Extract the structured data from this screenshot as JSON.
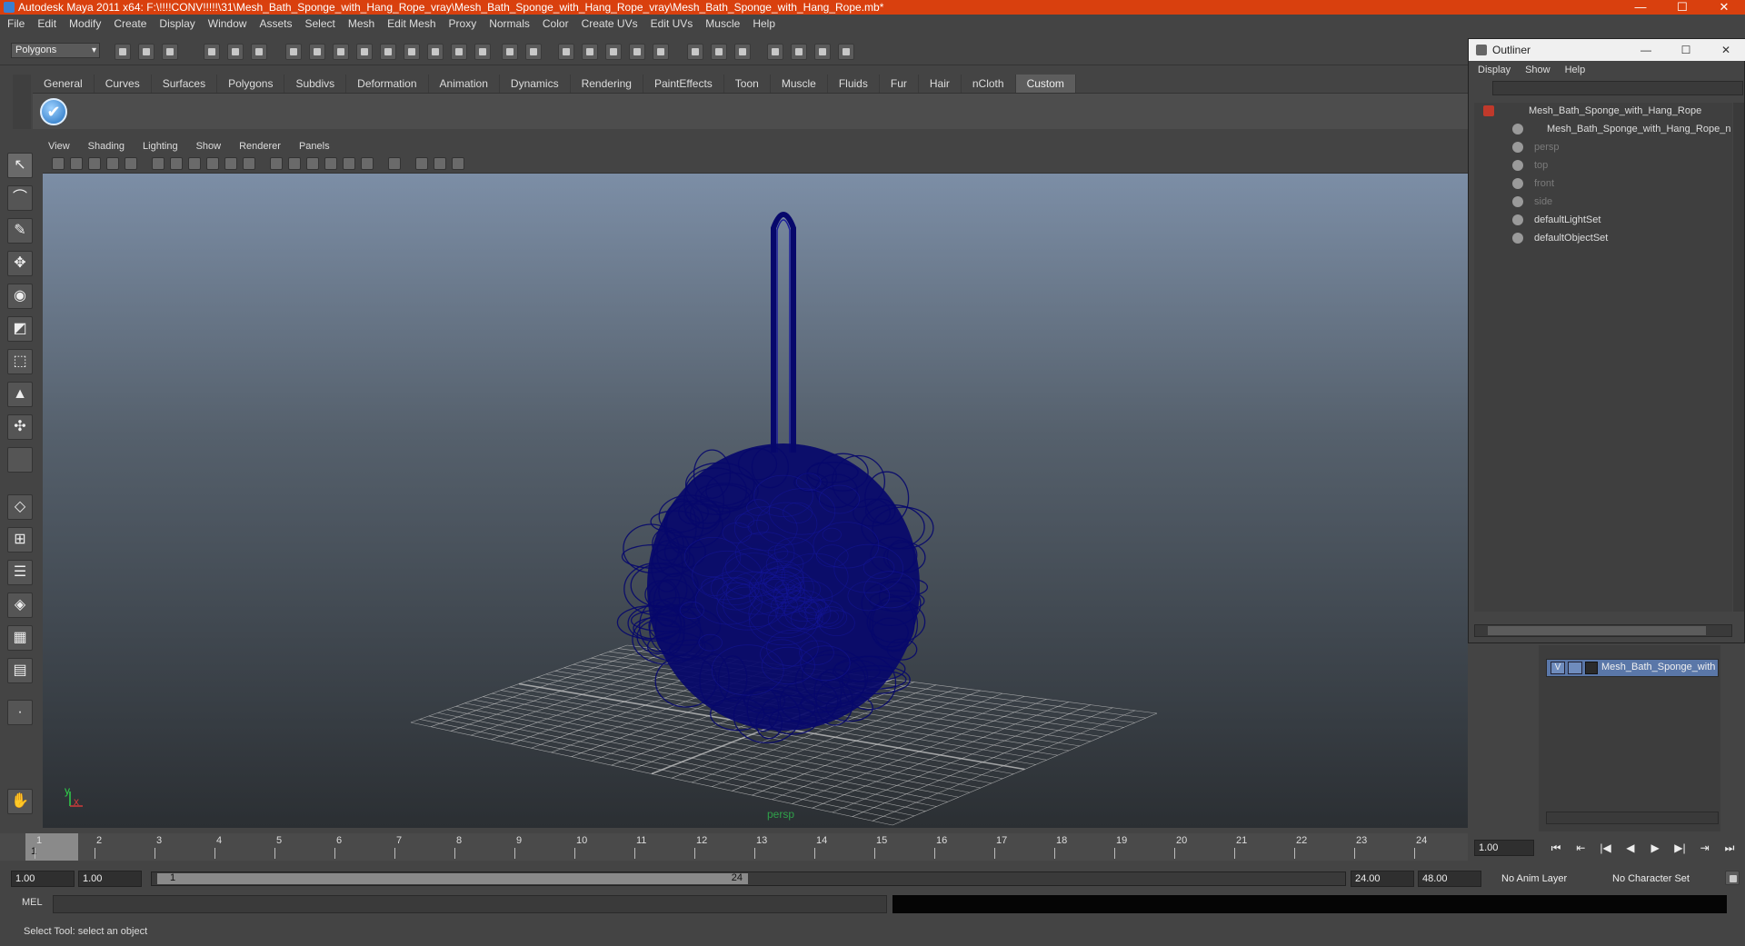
{
  "window": {
    "title": "Autodesk Maya 2011 x64: F:\\!!!!CONV!!!!!\\31\\Mesh_Bath_Sponge_with_Hang_Rope_vray\\Mesh_Bath_Sponge_with_Hang_Rope_vray\\Mesh_Bath_Sponge_with_Hang_Rope.mb*",
    "minimize": "—",
    "maximize": "☐",
    "close": "✕"
  },
  "menubar": [
    "File",
    "Edit",
    "Modify",
    "Create",
    "Display",
    "Window",
    "Assets",
    "Select",
    "Mesh",
    "Edit Mesh",
    "Proxy",
    "Normals",
    "Color",
    "Create UVs",
    "Edit UVs",
    "Muscle",
    "Help"
  ],
  "statusline": {
    "mode": "Polygons"
  },
  "shelf": {
    "tabs": [
      "General",
      "Curves",
      "Surfaces",
      "Polygons",
      "Subdivs",
      "Deformation",
      "Animation",
      "Dynamics",
      "Rendering",
      "PaintEffects",
      "Toon",
      "Muscle",
      "Fluids",
      "Fur",
      "Hair",
      "nCloth",
      "Custom"
    ],
    "active_tab": "Custom"
  },
  "viewport": {
    "menu": [
      "View",
      "Shading",
      "Lighting",
      "Show",
      "Renderer",
      "Panels"
    ],
    "camera_label": "persp",
    "axis_y": "y",
    "axis_x": "x",
    "mesh_color": "#07086b",
    "grid_color": "#c9c9c9"
  },
  "timeslider": {
    "ticks": [
      "1",
      "2",
      "3",
      "4",
      "5",
      "6",
      "7",
      "8",
      "9",
      "10",
      "11",
      "12",
      "13",
      "14",
      "15",
      "16",
      "17",
      "18",
      "19",
      "20",
      "21",
      "22",
      "23",
      "24"
    ],
    "current_frame": "1",
    "current_time": "1.00"
  },
  "playback": [
    "⏮",
    "⇤",
    "|◀",
    "◀",
    "▶",
    "▶|",
    "⇥",
    "⏭"
  ],
  "range": {
    "start": "1.00",
    "playback_start": "1.00",
    "handle_start": "1",
    "handle_end": "24",
    "playback_end": "24.00",
    "end": "48.00",
    "anim_layer": "No Anim Layer",
    "character_set": "No Character Set"
  },
  "commandline": {
    "label": "MEL"
  },
  "helpline": {
    "text": "Select Tool: select an object"
  },
  "outliner": {
    "title": "Outliner",
    "menu": [
      "Display",
      "Show",
      "Help"
    ],
    "items": [
      {
        "label": "Mesh_Bath_Sponge_with_Hang_Rope",
        "dim": false
      },
      {
        "label": "Mesh_Bath_Sponge_with_Hang_Rope_n",
        "dim": false
      },
      {
        "label": "persp",
        "dim": true
      },
      {
        "label": "top",
        "dim": true
      },
      {
        "label": "front",
        "dim": true
      },
      {
        "label": "side",
        "dim": true
      },
      {
        "label": "defaultLightSet",
        "dim": false
      },
      {
        "label": "defaultObjectSet",
        "dim": false
      }
    ]
  },
  "layer_editor": {
    "layer_name": "Mesh_Bath_Sponge_with",
    "visibility": "V"
  }
}
